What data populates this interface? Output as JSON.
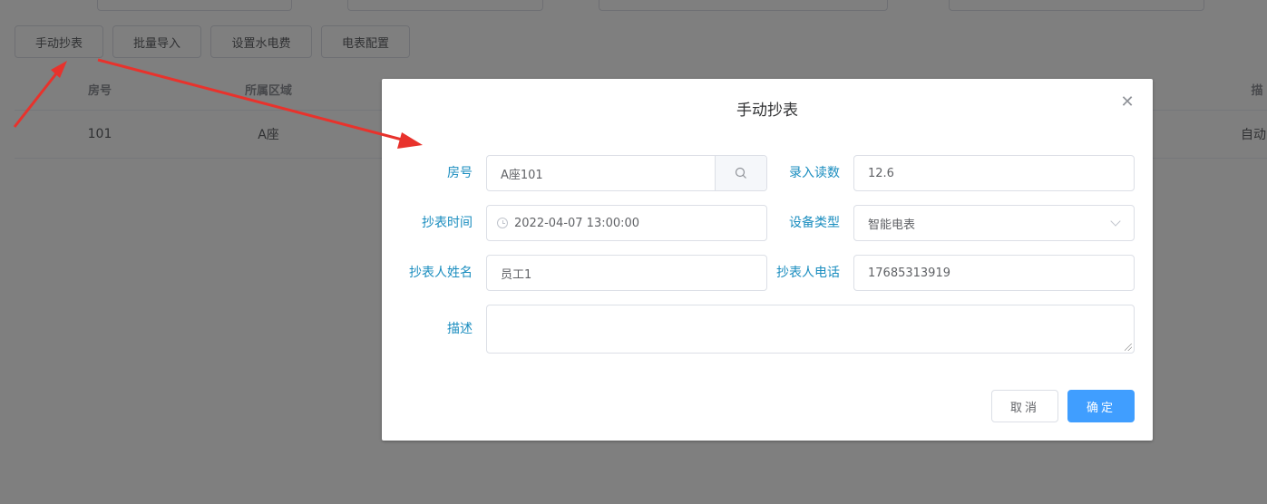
{
  "toolbar": {
    "manual_read_label": "手动抄表",
    "batch_import_label": "批量导入",
    "set_fee_label": "设置水电费",
    "meter_config_label": "电表配置"
  },
  "table": {
    "headers": [
      "房号",
      "所属区域",
      "描"
    ],
    "rows": [
      {
        "room": "101",
        "area": "A座",
        "desc": "自动"
      }
    ]
  },
  "dialog": {
    "title": "手动抄表",
    "close_icon": "close-icon",
    "fields": {
      "room_label": "房号",
      "room_value": "A座101",
      "reading_label": "录入读数",
      "reading_value": "12.6",
      "time_label": "抄表时间",
      "time_value": "2022-04-07 13:00:00",
      "device_type_label": "设备类型",
      "device_type_value": "智能电表",
      "reader_name_label": "抄表人姓名",
      "reader_name_value": "员工1",
      "reader_phone_label": "抄表人电话",
      "reader_phone_value": "17685313919",
      "desc_label": "描述",
      "desc_value": ""
    },
    "cancel_label": "取消",
    "ok_label": "确定"
  },
  "colors": {
    "label": "#1a8dbf",
    "primary": "#409eff",
    "annotation_arrow": "#e8322c"
  }
}
